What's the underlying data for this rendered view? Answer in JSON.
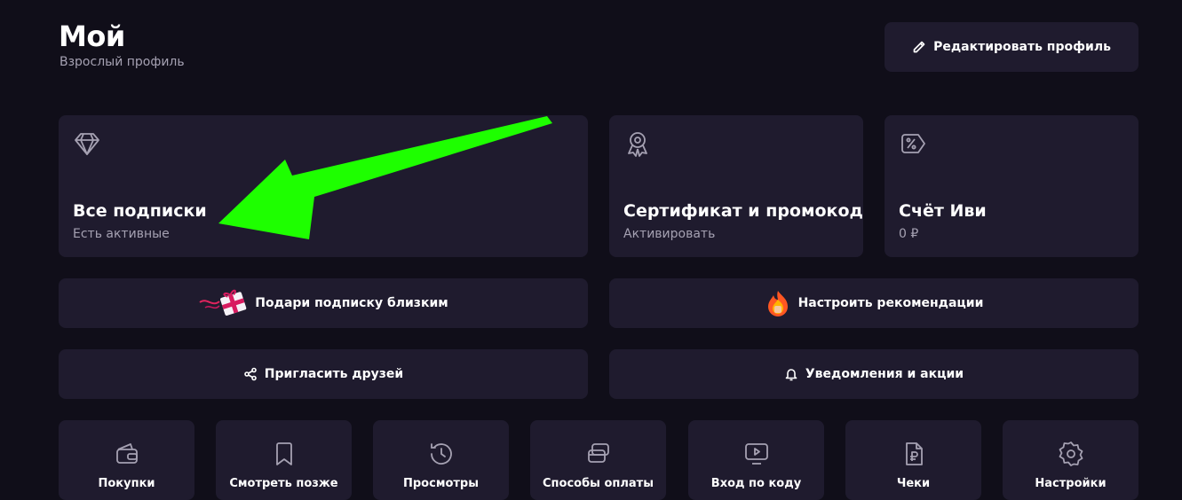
{
  "header": {
    "title": "Мой",
    "subtitle": "Взрослый профиль",
    "edit_label": "Редактировать профиль"
  },
  "cards": {
    "subscriptions": {
      "title": "Все подписки",
      "subtitle": "Есть активные",
      "icon": "diamond-icon"
    },
    "certificate": {
      "title": "Сертификат и промокод",
      "subtitle": "Активировать",
      "icon": "award-icon"
    },
    "account": {
      "title": "Счёт Иви",
      "subtitle": "0 ₽",
      "icon": "discount-tag-icon"
    }
  },
  "actions": {
    "gift": "Подари подписку близким",
    "recommendations": "Настроить рекомендации",
    "invite": "Пригласить друзей",
    "notifications": "Уведомления и акции"
  },
  "tiles": [
    {
      "label": "Покупки",
      "icon": "wallet-icon"
    },
    {
      "label": "Смотреть позже",
      "icon": "bookmark-icon"
    },
    {
      "label": "Просмотры",
      "icon": "history-icon"
    },
    {
      "label": "Способы оплаты",
      "icon": "payment-cards-icon"
    },
    {
      "label": "Вход по коду",
      "icon": "tv-play-icon"
    },
    {
      "label": "Чеки",
      "icon": "receipt-ruble-icon"
    },
    {
      "label": "Настройки",
      "icon": "settings-icon"
    }
  ],
  "colors": {
    "background": "#100e19",
    "card": "#1f1b2e",
    "muted_text": "#a5a1b2",
    "annotation_arrow": "#1eff00"
  }
}
